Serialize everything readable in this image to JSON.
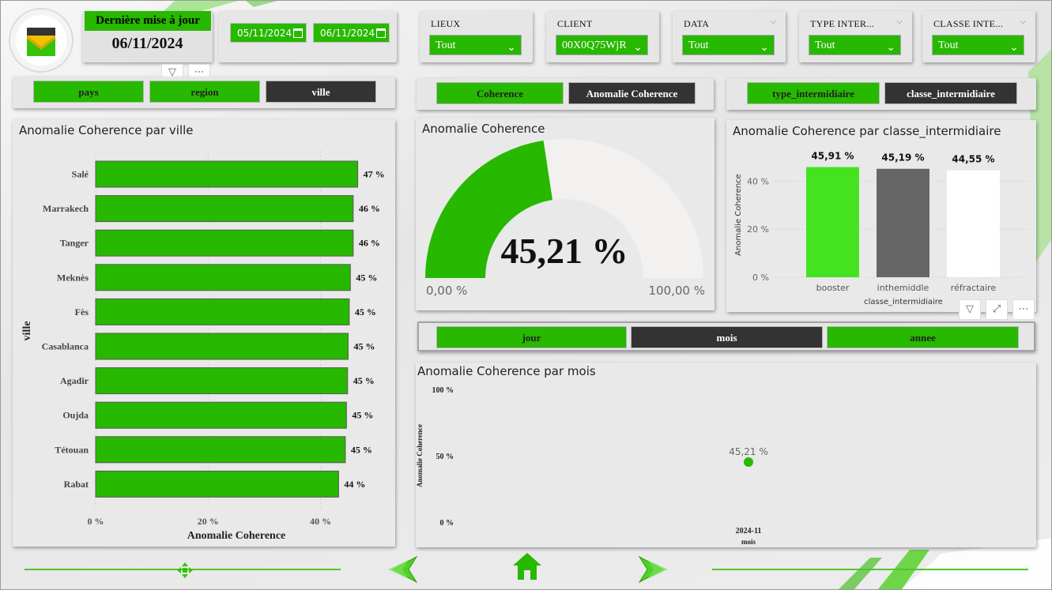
{
  "header": {
    "update_title": "Dernière mise à jour",
    "update_date": "06/11/2024",
    "date_start": "05/11/2024",
    "date_end": "06/11/2024"
  },
  "slicers": [
    {
      "label": "LIEUX",
      "value": "Tout"
    },
    {
      "label": "CLIENT",
      "value": "00X0Q75WjR"
    },
    {
      "label": "DATA",
      "value": "Tout"
    },
    {
      "label": "TYPE INTER...",
      "value": "Tout"
    },
    {
      "label": "CLASSE INTE...",
      "value": "Tout"
    }
  ],
  "geo_buttons": [
    {
      "label": "pays",
      "active": false
    },
    {
      "label": "region",
      "active": false
    },
    {
      "label": "ville",
      "active": true
    }
  ],
  "measure_buttons": [
    {
      "label": "Coherence",
      "active": false
    },
    {
      "label": "Anomalie Coherence",
      "active": true
    }
  ],
  "inter_buttons": [
    {
      "label": "type_intermidiaire",
      "active": false
    },
    {
      "label": "classe_intermidiaire",
      "active": true
    }
  ],
  "time_buttons": [
    {
      "label": "jour",
      "active": false
    },
    {
      "label": "mois",
      "active": true
    },
    {
      "label": "annee",
      "active": false
    }
  ],
  "colors": {
    "accent": "#27b800",
    "dark": "#333333",
    "gauge_track": "#f2f1ef",
    "bar_booster": "#45e31f",
    "bar_inthemiddle": "#666666",
    "bar_refractaire": "#ffffff"
  },
  "icons": [
    "filter-icon",
    "more-icon",
    "expand-icon",
    "calendar-icon",
    "home-icon",
    "arrow-left-icon",
    "arrow-right-icon"
  ],
  "chart_data": [
    {
      "id": "ville",
      "type": "bar",
      "orientation": "horizontal",
      "title": "Anomalie Coherence par ville",
      "xlabel": "Anomalie Coherence",
      "ylabel": "ville",
      "categories": [
        "Salé",
        "Marrakech",
        "Tanger",
        "Meknès",
        "Fès",
        "Casablanca",
        "Agadir",
        "Oujda",
        "Tétouan",
        "Rabat"
      ],
      "values": [
        46.6,
        45.8,
        45.8,
        45.3,
        45.1,
        44.9,
        44.8,
        44.6,
        44.4,
        43.2
      ],
      "data_labels": [
        "47 %",
        "46 %",
        "46 %",
        "45 %",
        "45 %",
        "45 %",
        "45 %",
        "45 %",
        "45 %",
        "44 %"
      ],
      "xticks": [
        "0 %",
        "20 %",
        "40 %"
      ],
      "xlim": [
        0,
        52
      ]
    },
    {
      "id": "gauge",
      "type": "gauge",
      "title": "Anomalie Coherence",
      "value": 45.21,
      "value_label": "45,21 %",
      "min_label": "0,00 %",
      "max_label": "100,00 %",
      "range": [
        0,
        100
      ]
    },
    {
      "id": "classe",
      "type": "bar",
      "title": "Anomalie Coherence par classe_intermidiaire",
      "xlabel": "classe_intermidiaire",
      "ylabel": "Anomalie Coherence",
      "categories": [
        "booster",
        "inthemiddle",
        "réfractaire"
      ],
      "values": [
        45.91,
        45.19,
        44.55
      ],
      "data_labels": [
        "45,91 %",
        "45,19 %",
        "44,55 %"
      ],
      "yticks": [
        "0 %",
        "20 %",
        "40 %"
      ],
      "ylim": [
        0,
        53
      ]
    },
    {
      "id": "mois",
      "type": "scatter",
      "title": "Anomalie Coherence par mois",
      "xlabel": "mois",
      "ylabel": "Anomalie Coherence",
      "x": [
        "2024-11"
      ],
      "y": [
        45.21
      ],
      "data_labels": [
        "45,21 %"
      ],
      "yticks": [
        "100 %",
        "50 %",
        "0 %"
      ],
      "ylim": [
        0,
        100
      ]
    }
  ]
}
